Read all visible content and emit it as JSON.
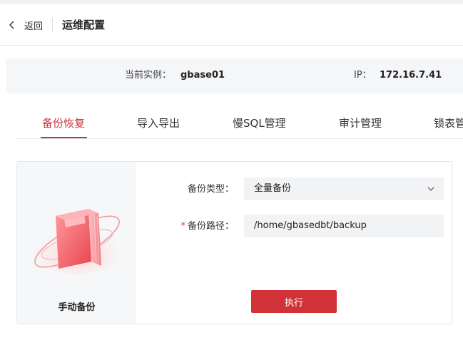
{
  "header": {
    "back_label": "返回",
    "title": "运维配置"
  },
  "instance": {
    "instance_label": "当前实例：",
    "instance_value": "gbase01",
    "ip_label": "IP：",
    "ip_value": "172.16.7.41"
  },
  "tabs": [
    {
      "label": "备份恢复",
      "active": true
    },
    {
      "label": "导入导出",
      "active": false
    },
    {
      "label": "慢SQL管理",
      "active": false
    },
    {
      "label": "审计管理",
      "active": false
    },
    {
      "label": "锁表管",
      "active": false
    }
  ],
  "backup_card": {
    "title": "手动备份",
    "type_label": "备份类型：",
    "type_value": "全量备份",
    "path_required_mark": "*",
    "path_label": "备份路径：",
    "path_value": "/home/gbasedbt/backup",
    "execute_label": "执行"
  },
  "colors": {
    "accent": "#c8323a",
    "button": "#d13237"
  },
  "icons": {
    "back": "chevron-left-icon",
    "select": "chevron-down-icon",
    "illustration": "backup-book-illustration"
  }
}
